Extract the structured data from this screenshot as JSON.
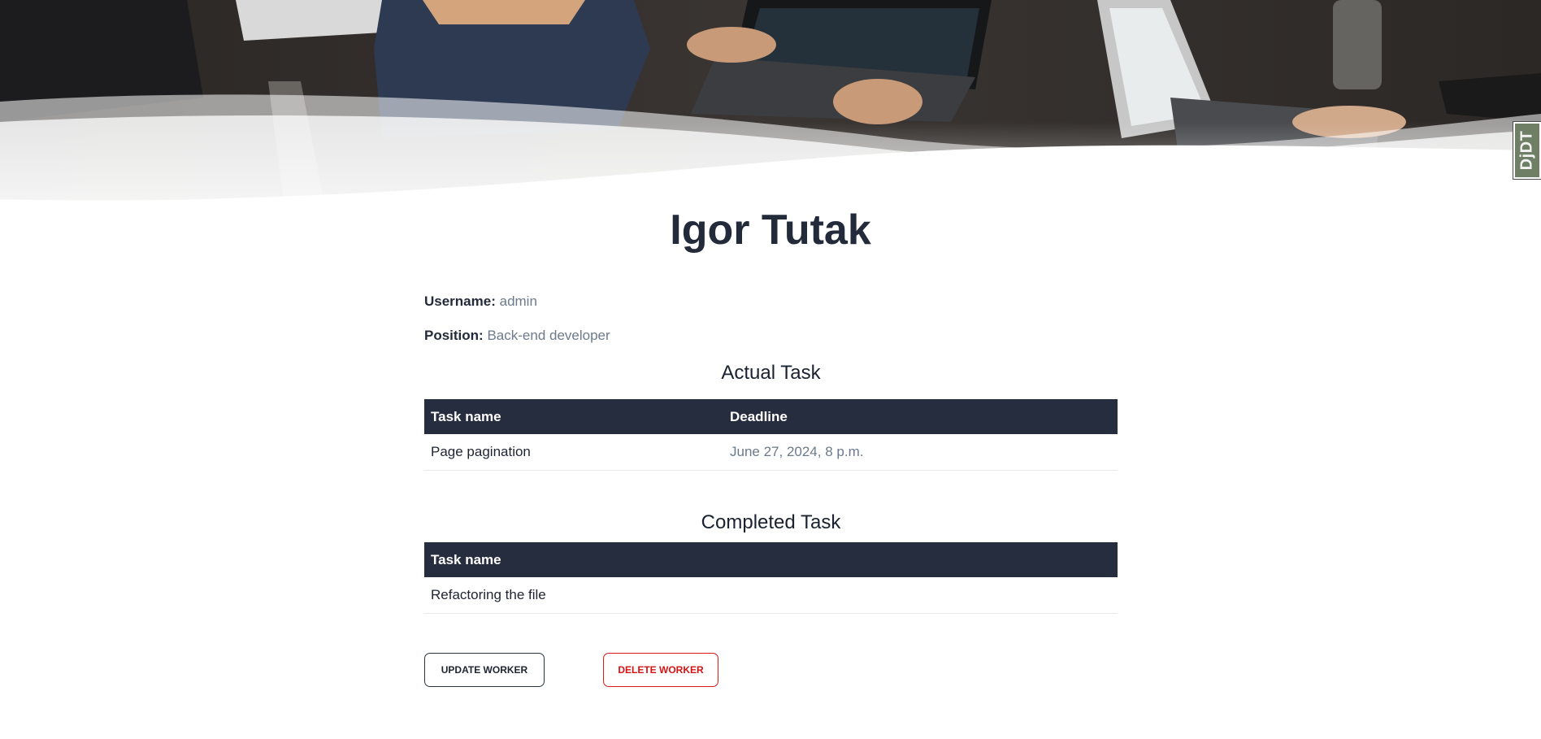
{
  "worker": {
    "name": "Igor Tutak",
    "username_label": "Username:",
    "username": "admin",
    "position_label": "Position:",
    "position": "Back-end developer"
  },
  "actual_tasks": {
    "title": "Actual Task",
    "headers": [
      "Task name",
      "Deadline"
    ],
    "rows": [
      {
        "task": "Page pagination",
        "deadline": "June 27, 2024, 8 p.m."
      }
    ]
  },
  "completed_tasks": {
    "title": "Completed Task",
    "headers": [
      "Task name"
    ],
    "rows": [
      {
        "task": "Refactoring the file"
      }
    ]
  },
  "actions": {
    "update_label": "UPDATE WORKER",
    "delete_label": "DELETE WORKER"
  },
  "debug_toolbar": {
    "label": "DjDT"
  },
  "colors": {
    "header_bg": "#252d3e",
    "heading_text": "#232b3b",
    "muted_text": "#6c7a8c",
    "danger": "#e01818"
  }
}
